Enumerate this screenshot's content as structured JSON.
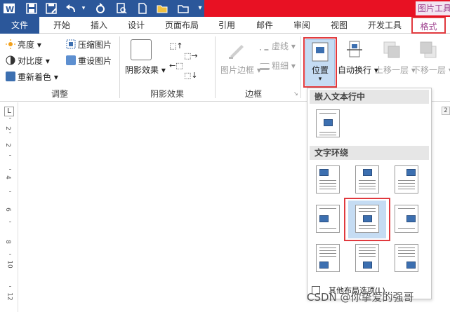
{
  "quick_access": {
    "icons": [
      "word-icon",
      "save-icon",
      "save-as-icon",
      "undo-icon",
      "redo-icon",
      "print-preview-icon",
      "new-doc-icon",
      "open-folder-icon",
      "customize-icon"
    ],
    "context_tab_label": "图片工具"
  },
  "tabs": [
    {
      "label": "文件"
    },
    {
      "label": "开始"
    },
    {
      "label": "插入"
    },
    {
      "label": "设计"
    },
    {
      "label": "页面布局"
    },
    {
      "label": "引用"
    },
    {
      "label": "邮件"
    },
    {
      "label": "审阅"
    },
    {
      "label": "视图"
    },
    {
      "label": "开发工具"
    },
    {
      "label": "格式"
    }
  ],
  "ribbon": {
    "adjust": {
      "brightness": "亮度",
      "contrast": "对比度",
      "recolor": "重新着色",
      "compress": "压缩图片",
      "reset": "重设图片",
      "group_label": "调整"
    },
    "shadow": {
      "button_label": "阴影效果",
      "group_label": "阴影效果"
    },
    "border": {
      "picture_border": "图片边框",
      "dash": "虚线",
      "weight": "粗细",
      "group_label": "边框"
    },
    "arrange": {
      "position": "位置",
      "wrap": "自动换行",
      "bring_forward": "上移一层",
      "send_backward": "下移一层"
    }
  },
  "dropdown": {
    "section_inline": "嵌入文本行中",
    "section_wrap": "文字环绕",
    "more_options": "其他布局选项(L)..."
  },
  "ruler": {
    "corner": "L",
    "right_marker": "2",
    "numbers": [
      "2",
      "2",
      "4",
      "6",
      "8",
      "10",
      "12"
    ]
  },
  "watermark": "CSDN @你挚爱的强哥",
  "colors": {
    "word_blue": "#2b579a",
    "title_red": "#e81123",
    "format_purple": "#9c3c8c",
    "highlight_red": "#e0393e",
    "selected_blue": "#c5dcf3"
  }
}
